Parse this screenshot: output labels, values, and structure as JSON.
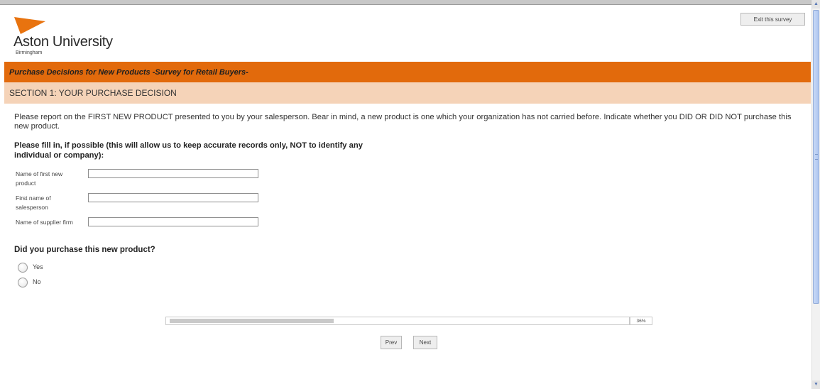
{
  "header": {
    "logo_name": "Aston University",
    "logo_sub": "Birmingham",
    "exit_label": "Exit this survey",
    "brand_color": "#e26a0c"
  },
  "survey": {
    "title": "Purchase Decisions for New Products -Survey for Retail Buyers-",
    "section": "SECTION 1: YOUR PURCHASE DECISION",
    "intro": "Please report on the FIRST NEW PRODUCT presented to you by your salesperson. Bear in mind, a new product is one which your organization has not carried before. Indicate whether you DID OR DID NOT purchase this new product.",
    "fill_heading": "Please fill in, if possible (this will allow us to keep accurate records only, NOT to identify any individual or company):",
    "fields": [
      {
        "label": "Name of first new product",
        "value": ""
      },
      {
        "label": "First name of salesperson",
        "value": ""
      },
      {
        "label": "Name of supplier firm",
        "value": ""
      }
    ],
    "question": "Did you purchase this new product?",
    "options": [
      "Yes",
      "No"
    ]
  },
  "progress": {
    "percent_label": "36%",
    "fraction": 0.36
  },
  "nav": {
    "prev_label": "Prev",
    "next_label": "Next"
  },
  "icons": {
    "logo": "aston-logo-icon",
    "scroll_up": "scroll-up-arrow-icon",
    "scroll_down": "scroll-down-arrow-icon"
  }
}
